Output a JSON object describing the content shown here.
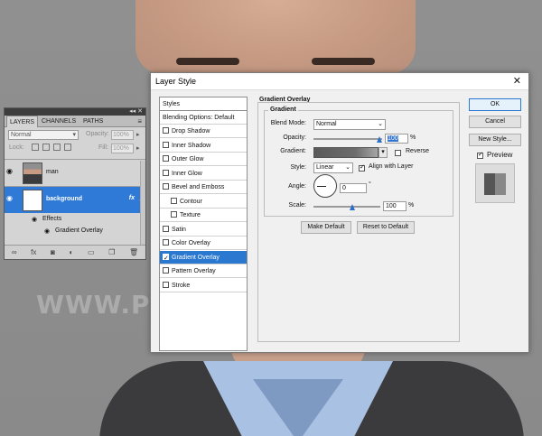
{
  "layers_panel": {
    "tabs": [
      "LAYERS",
      "CHANNELS",
      "PATHS"
    ],
    "blend_mode": "Normal",
    "opacity_label": "Opacity:",
    "opacity_value": "100%",
    "lock_label": "Lock:",
    "fill_label": "Fill:",
    "fill_value": "100%",
    "layers": [
      {
        "name": "man"
      },
      {
        "name": "background",
        "fx": "fx"
      }
    ],
    "effects_label": "Effects",
    "effect_item": "Gradient Overlay"
  },
  "dialog": {
    "title": "Layer Style",
    "styles_header": "Styles",
    "blending_options": "Blending Options: Default",
    "style_items": [
      {
        "label": "Drop Shadow",
        "checked": false
      },
      {
        "label": "Inner Shadow",
        "checked": false
      },
      {
        "label": "Outer Glow",
        "checked": false
      },
      {
        "label": "Inner Glow",
        "checked": false
      },
      {
        "label": "Bevel and Emboss",
        "checked": false
      },
      {
        "label": "Contour",
        "checked": false
      },
      {
        "label": "Texture",
        "checked": false
      },
      {
        "label": "Satin",
        "checked": false
      },
      {
        "label": "Color Overlay",
        "checked": false
      },
      {
        "label": "Gradient Overlay",
        "checked": true
      },
      {
        "label": "Pattern Overlay",
        "checked": false
      },
      {
        "label": "Stroke",
        "checked": false
      }
    ],
    "section_title": "Gradient Overlay",
    "group_title": "Gradient",
    "blend_mode_label": "Blend Mode:",
    "blend_mode_value": "Normal",
    "opacity_label": "Opacity:",
    "opacity_value": "100",
    "opacity_unit": "%",
    "gradient_label": "Gradient:",
    "reverse_label": "Reverse",
    "style_label": "Style:",
    "style_value": "Linear",
    "align_label": "Align with Layer",
    "angle_label": "Angle:",
    "angle_value": "0",
    "angle_unit": "°",
    "scale_label": "Scale:",
    "scale_value": "100",
    "scale_unit": "%",
    "make_default": "Make Default",
    "reset_default": "Reset to Default",
    "ok": "OK",
    "cancel": "Cancel",
    "new_style": "New Style...",
    "preview_label": "Preview"
  },
  "watermark": "WWW.PHOTOSHOPSUPPLY.COM"
}
